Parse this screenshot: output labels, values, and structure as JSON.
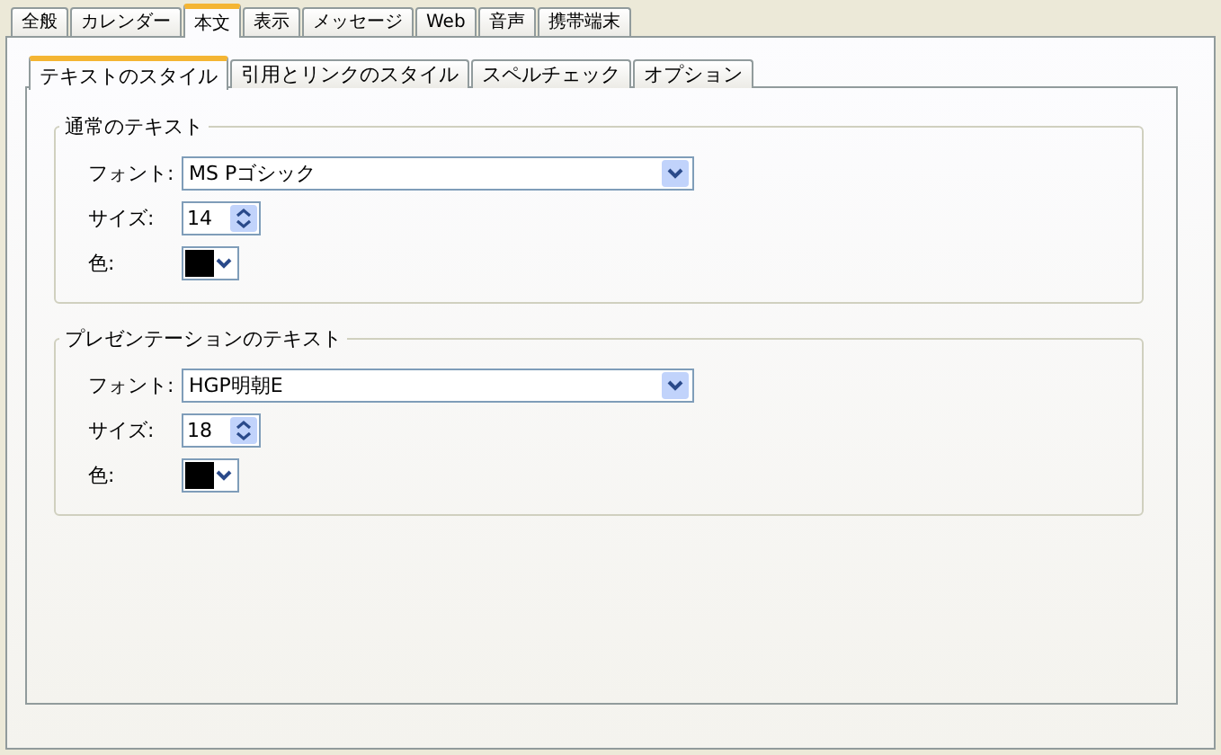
{
  "tabs": [
    {
      "label": "全般",
      "selected": false
    },
    {
      "label": "カレンダー",
      "selected": false
    },
    {
      "label": "本文",
      "selected": true
    },
    {
      "label": "表示",
      "selected": false
    },
    {
      "label": "メッセージ",
      "selected": false
    },
    {
      "label": "Web",
      "selected": false
    },
    {
      "label": "音声",
      "selected": false
    },
    {
      "label": "携帯端末",
      "selected": false
    }
  ],
  "subtabs": [
    {
      "label": "テキストのスタイル",
      "selected": true
    },
    {
      "label": "引用とリンクのスタイル",
      "selected": false
    },
    {
      "label": "スペルチェック",
      "selected": false
    },
    {
      "label": "オプション",
      "selected": false
    }
  ],
  "groups": [
    {
      "title": "通常のテキスト",
      "font_label": "フォント:",
      "font": "MS Pゴシック",
      "size_label": "サイズ:",
      "size": "14",
      "color_label": "色:",
      "color": "#000000"
    },
    {
      "title": "プレゼンテーションのテキスト",
      "font_label": "フォント:",
      "font": "HGP明朝E",
      "size_label": "サイズ:",
      "size": "18",
      "color_label": "色:",
      "color": "#000000"
    }
  ]
}
